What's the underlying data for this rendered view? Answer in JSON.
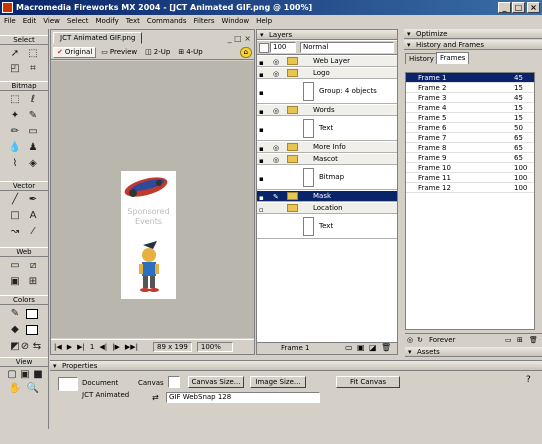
{
  "window": {
    "title": "Macromedia Fireworks MX 2004 - [JCT Animated GIF.png @ 100%]"
  },
  "menu": [
    "File",
    "Edit",
    "View",
    "Select",
    "Modify",
    "Text",
    "Commands",
    "Filters",
    "Window",
    "Help"
  ],
  "tools": {
    "select_label": "Select",
    "bitmap_label": "Bitmap",
    "vector_label": "Vector",
    "web_label": "Web",
    "colors_label": "Colors",
    "view_label": "View"
  },
  "document": {
    "tab_title": "JCT Animated GIF.png",
    "view_tabs": [
      "Original",
      "Preview",
      "2-Up",
      "4-Up"
    ],
    "image_text": [
      "Sponsored",
      "Events"
    ],
    "status": {
      "frame": "1",
      "size": "89 x 199",
      "zoom": "100%"
    }
  },
  "layers": {
    "header": "Layers",
    "opacity": "100",
    "blend_mode": "Normal",
    "rows": [
      {
        "type": "folder",
        "name": "Web Layer"
      },
      {
        "type": "folder",
        "name": "Logo"
      },
      {
        "type": "object",
        "name": "Group: 4 objects"
      },
      {
        "type": "folder",
        "name": "Words"
      },
      {
        "type": "object",
        "name": "Text"
      },
      {
        "type": "folder",
        "name": "More Info"
      },
      {
        "type": "folder",
        "name": "Mascot"
      },
      {
        "type": "object",
        "name": "Bitmap"
      },
      {
        "type": "folder",
        "name": "Mask",
        "selected": true
      },
      {
        "type": "folder",
        "name": "Location"
      },
      {
        "type": "object",
        "name": "Text"
      }
    ],
    "footer_label": "Frame 1"
  },
  "right_panels": {
    "optimize_header": "Optimize",
    "history_frames_header": "History and Frames",
    "tabs": [
      "History",
      "Frames"
    ],
    "frames": [
      {
        "name": "Frame 1",
        "delay": "45",
        "selected": true
      },
      {
        "name": "Frame 2",
        "delay": "15"
      },
      {
        "name": "Frame 3",
        "delay": "45"
      },
      {
        "name": "Frame 4",
        "delay": "15"
      },
      {
        "name": "Frame 5",
        "delay": "15"
      },
      {
        "name": "Frame 6",
        "delay": "50"
      },
      {
        "name": "Frame 7",
        "delay": "65"
      },
      {
        "name": "Frame 8",
        "delay": "65"
      },
      {
        "name": "Frame 9",
        "delay": "65"
      },
      {
        "name": "Frame 10",
        "delay": "100"
      },
      {
        "name": "Frame 11",
        "delay": "100"
      },
      {
        "name": "Frame 12",
        "delay": "100"
      }
    ],
    "loop_label": "Forever",
    "assets_header": "Assets"
  },
  "properties": {
    "header": "Properties",
    "doc_type": "Document",
    "doc_name": "JCT Animated",
    "canvas_label": "Canvas",
    "canvas_size_button": "Canvas Size...",
    "image_size_button": "Image Size...",
    "fit_canvas_button": "Fit Canvas",
    "export_format": "GIF WebSnap 128"
  },
  "colors": {
    "titlebar": "#0a246a",
    "selection": "#0a246a",
    "chrome": "#d4d0c8"
  }
}
